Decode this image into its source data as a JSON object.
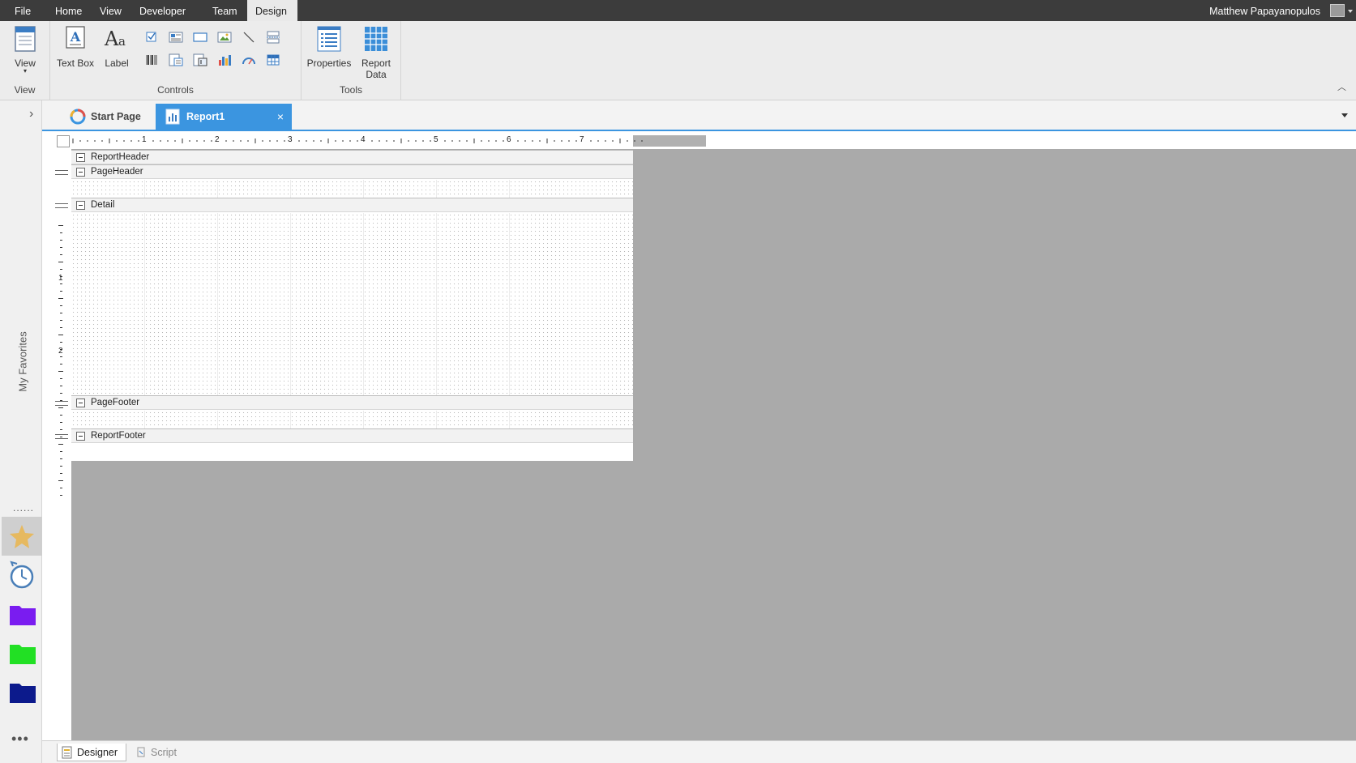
{
  "menubar": {
    "items": [
      "File",
      "Home",
      "View",
      "Developer",
      "Team",
      "Design"
    ],
    "active": "Design",
    "user_name": "Matthew Papayanopulos"
  },
  "ribbon": {
    "view_group": {
      "button_label": "View",
      "group_label": "View"
    },
    "controls_group": {
      "text_box_label": "Text Box",
      "label_label": "Label",
      "group_label": "Controls",
      "small_icons": [
        "checkbox-icon",
        "richtext-icon",
        "shape-icon",
        "image-icon",
        "line-icon",
        "pagebreak-icon",
        "barcode-icon",
        "subreport-icon",
        "inputfield-icon",
        "chart-icon",
        "sparkline-icon",
        "table-icon"
      ]
    },
    "tools_group": {
      "properties_label": "Properties",
      "report_data_label_1": "Report",
      "report_data_label_2": "Data",
      "group_label": "Tools"
    }
  },
  "sidebar": {
    "title": "My Favorites",
    "items": [
      "favorites-star",
      "recent-history",
      "folder-purple",
      "folder-green",
      "folder-navy"
    ],
    "colors": {
      "star": "#e6b960",
      "history": "#4a7fb8",
      "folder_purple": "#7a1cf0",
      "folder_green": "#22e024",
      "folder_navy": "#0c1a8c"
    }
  },
  "tabs": {
    "start_page": "Start Page",
    "report": "Report1",
    "close_glyph": "×"
  },
  "designer": {
    "ruler_h_labels": [
      "1",
      "2",
      "3",
      "4",
      "5",
      "6",
      "7"
    ],
    "ruler_v_labels": [
      "1",
      "2"
    ],
    "bands": [
      "ReportHeader",
      "PageHeader",
      "Detail",
      "PageFooter",
      "ReportFooter"
    ]
  },
  "bottom_tabs": {
    "designer": "Designer",
    "script": "Script"
  },
  "accent": "#3b95e0"
}
